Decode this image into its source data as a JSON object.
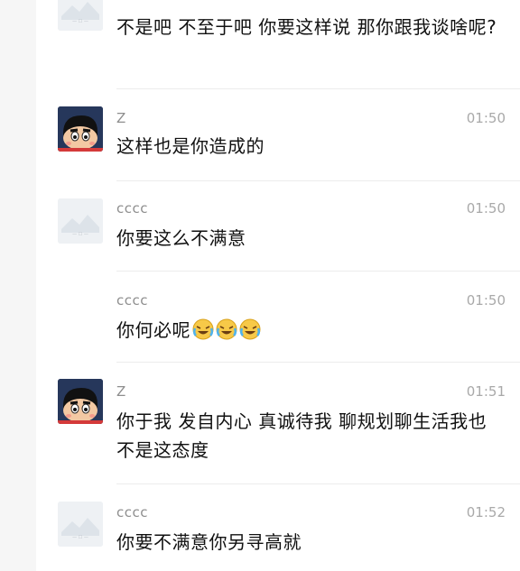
{
  "messages": [
    {
      "sender": "",
      "time": "",
      "text": "不是吧 不至于吧 你要这样说 那你跟我谈啥呢?",
      "avatar": "placeholder-image-icon",
      "emojis": []
    },
    {
      "sender": "Z",
      "time": "01:50",
      "text": "这样也是你造成的",
      "avatar": "crayon-shinchan-avatar",
      "emojis": []
    },
    {
      "sender": "cccc",
      "time": "01:50",
      "text": "你要这么不满意",
      "avatar": "placeholder-image-icon",
      "emojis": []
    },
    {
      "sender": "cccc",
      "time": "01:50",
      "text": "你何必呢",
      "avatar": "none",
      "emojis": [
        "laughing-crying-emoji",
        "laughing-crying-emoji",
        "laughing-crying-emoji"
      ]
    },
    {
      "sender": "Z",
      "time": "01:51",
      "text": "你于我 发自内心 真诚待我 聊规划聊生活我也不是这态度",
      "avatar": "crayon-shinchan-avatar",
      "emojis": []
    },
    {
      "sender": "cccc",
      "time": "01:52",
      "text": "你要不满意你另寻高就",
      "avatar": "placeholder-image-icon",
      "emojis": []
    }
  ],
  "colors": {
    "background": "#ffffff",
    "left_strip": "#f6f6f6",
    "sender": "#8e8e8e",
    "time": "#a9a9a9",
    "text": "#111111",
    "separator": "#ececec"
  }
}
